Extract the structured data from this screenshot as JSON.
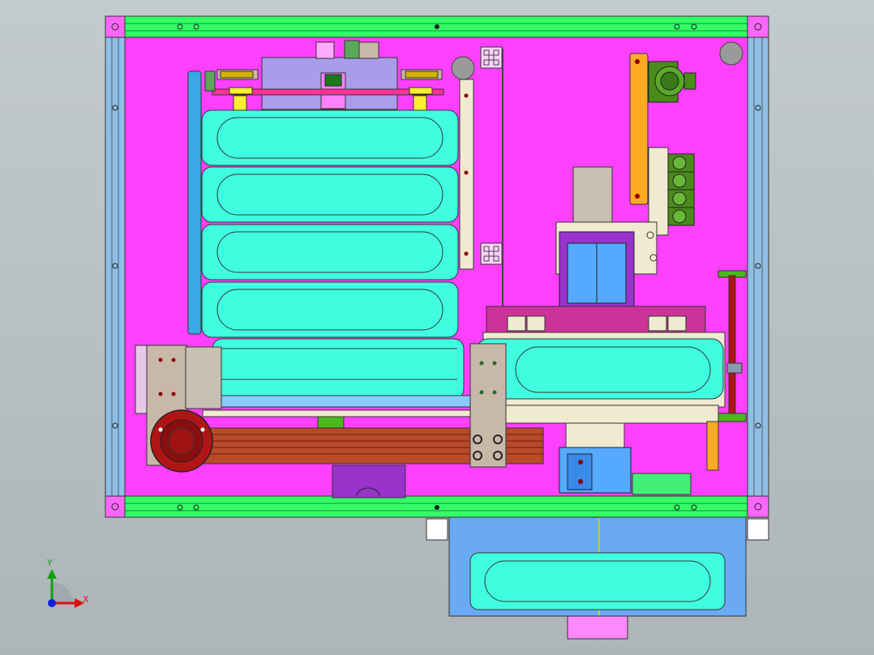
{
  "viewport": {
    "background": "#b8bfc3"
  },
  "triad": {
    "x_label": "X",
    "y_label": "Y",
    "x_color": "#e01010",
    "y_color": "#10a010",
    "z_color": "#1020e0"
  },
  "colors": {
    "base_plate": "#ff40ff",
    "rail_green": "#33ff66",
    "side_frame": "#8fbfe6",
    "battery_cell": "#40ffe0",
    "cylinder_blue": "#55aaff",
    "motor_red": "#b01515",
    "belt_brown": "#b84a2a",
    "bracket_gray": "#c8b8a8",
    "lavender": "#a99ce8",
    "orange": "#ffaa22",
    "purple_block": "#9933cc",
    "olive_green": "#4a8c1a",
    "output_tray": "#6aaaf5"
  },
  "icons": {
    "triad": "xyz-axis-triad-icon"
  }
}
